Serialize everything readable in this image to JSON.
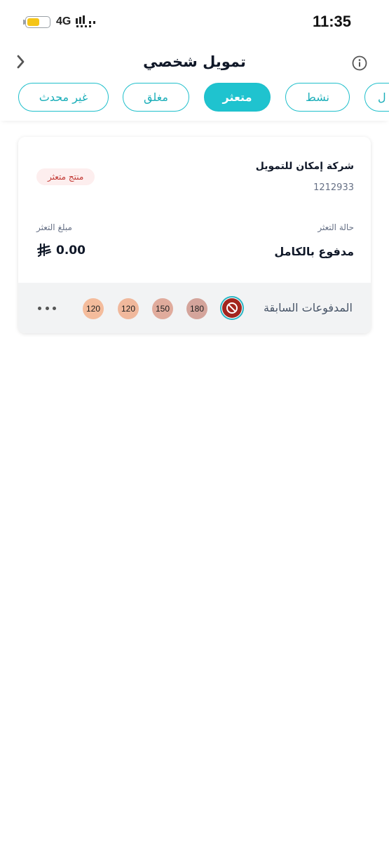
{
  "status_bar": {
    "network": "4G",
    "time": "11:35",
    "battery_level": 0.6,
    "battery_color": "#f5c518"
  },
  "header": {
    "title": "تمويل شخصي",
    "back_icon": "chevron-right-icon",
    "info_icon": "info-icon"
  },
  "tabs": [
    {
      "label": "غير محدث",
      "active": false
    },
    {
      "label": "مغلق",
      "active": false
    },
    {
      "label": "متعثر",
      "active": true
    },
    {
      "label": "نشط",
      "active": false
    },
    {
      "label": "ل",
      "active": false
    }
  ],
  "card": {
    "company": "شركة إمكان للتمويل",
    "reference": "1212933",
    "badge": "منتج متعثر",
    "status_label": "حالة التعثر",
    "status_value": "مدفوع بالكامل",
    "amount_label": "مبلغ التعثر",
    "amount_value": "0.00",
    "currency_symbol": "⃁",
    "previous_payments_label": "المدفوعات السابقة",
    "previous_payments": [
      {
        "value": "180",
        "color": "#d4a49b"
      },
      {
        "value": "150",
        "color": "#e0ab9c"
      },
      {
        "value": "120",
        "color": "#f0b89c"
      },
      {
        "value": "120",
        "color": "#f4bc9c"
      }
    ],
    "blocked_icon": "blocked-icon",
    "more_icon": "more-dots-icon"
  },
  "colors": {
    "accent": "#1fc3cf",
    "badge_text": "#c23934",
    "badge_bg": "#fdeeee",
    "blocked": "#a3261f"
  }
}
